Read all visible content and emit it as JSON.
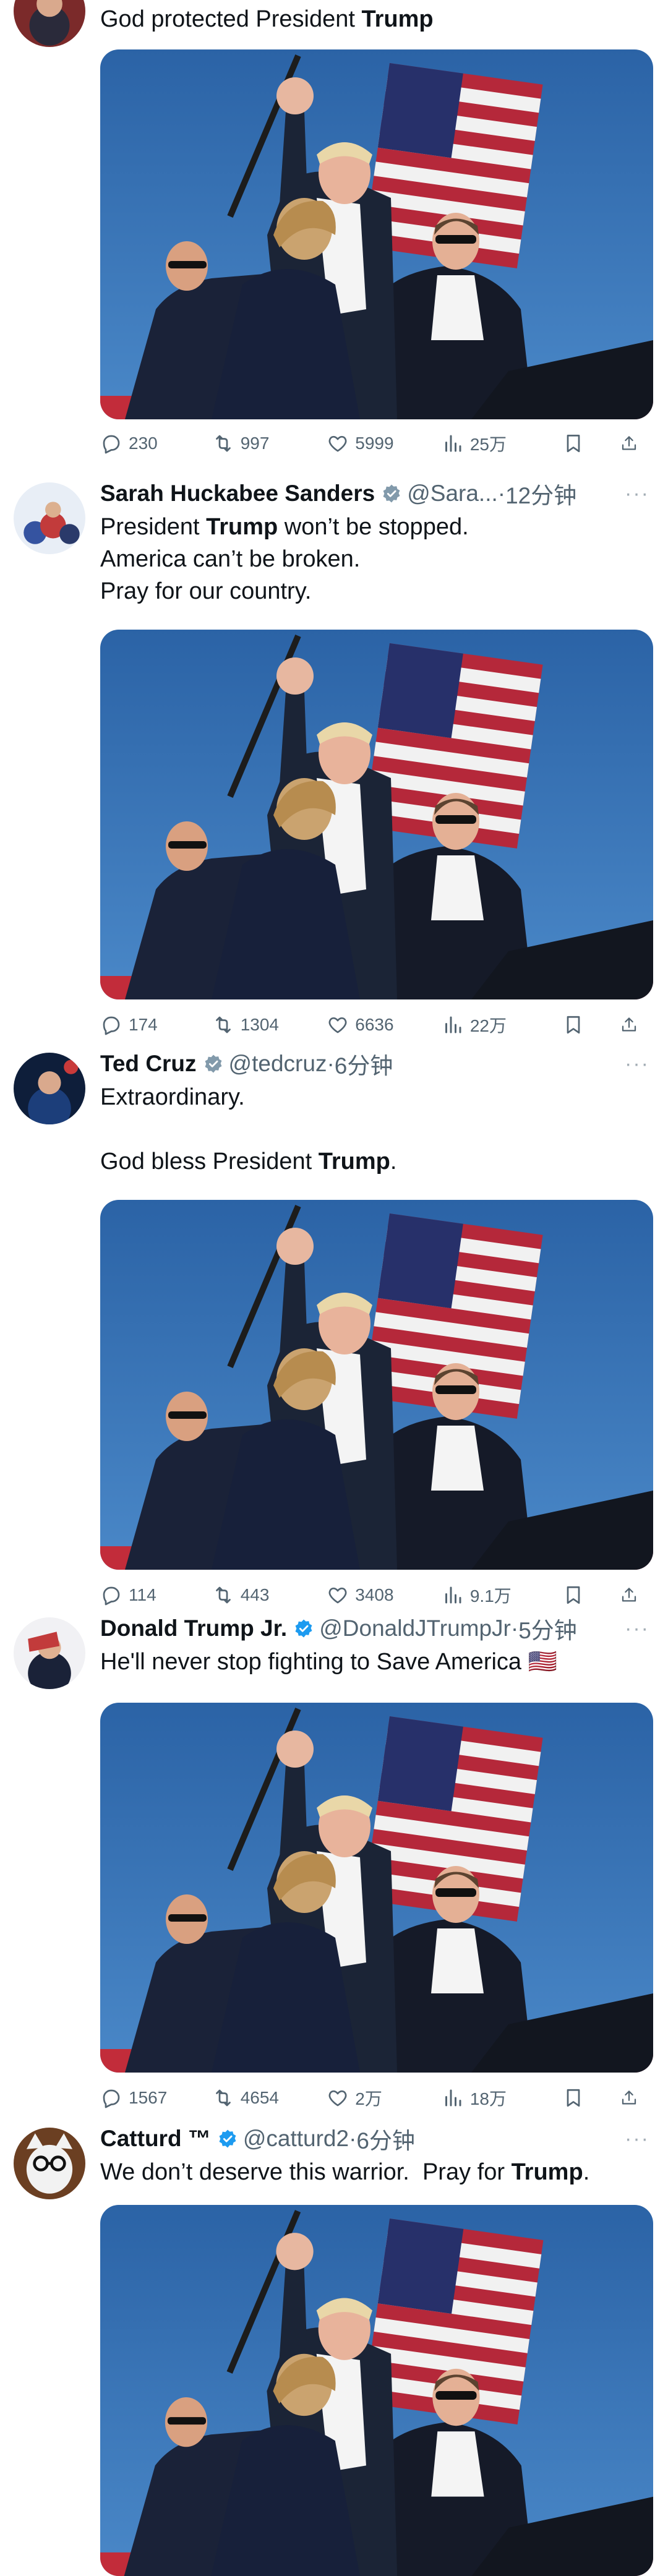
{
  "tweets": [
    {
      "name": "",
      "handle": "",
      "time": "",
      "verified": false,
      "text_before": "God protected President ",
      "text_bold": "Trump",
      "text_after": "",
      "stats": {
        "replies": "230",
        "retweets": "997",
        "likes": "5999",
        "views": "25万"
      }
    },
    {
      "name": "Sarah Huckabee Sanders",
      "handle": "@Sara...",
      "time": "12分钟",
      "verified": true,
      "text_before": "President ",
      "text_bold": "Trump",
      "text_after": " won’t be stopped.\nAmerica can’t be broken.\nPray for our country.",
      "stats": {
        "replies": "174",
        "retweets": "1304",
        "likes": "6636",
        "views": "22万"
      }
    },
    {
      "name": "Ted Cruz",
      "handle": "@tedcruz",
      "time": "6分钟",
      "verified": true,
      "text_before": "Extraordinary.\n\nGod bless President ",
      "text_bold": "Trump",
      "text_after": ".",
      "stats": {
        "replies": "114",
        "retweets": "443",
        "likes": "3408",
        "views": "9.1万"
      }
    },
    {
      "name": "Donald Trump Jr.",
      "handle": "@DonaldJTrumpJr",
      "time": "5分钟",
      "verified": true,
      "text_before": "He'll never stop fighting to Save America 🇺🇸",
      "text_bold": "",
      "text_after": "",
      "stats": {
        "replies": "1567",
        "retweets": "4654",
        "likes": "2万",
        "views": "18万"
      }
    },
    {
      "name": "Catturd ™",
      "handle": "@catturd2",
      "time": "6分钟",
      "verified": true,
      "text_before": "We don’t deserve this warrior.  Pray for ",
      "text_bold": "Trump",
      "text_after": ".",
      "stats": {
        "replies": "",
        "retweets": "",
        "likes": "",
        "views": ""
      }
    }
  ],
  "ui": {
    "dot": "·",
    "more": "···"
  },
  "icons": [
    "reply-icon",
    "retweet-icon",
    "like-icon",
    "views-icon",
    "bookmark-icon",
    "share-icon",
    "verified-badge-icon"
  ],
  "colors": {
    "text": "#0f1419",
    "secondary": "#536471",
    "verified": "#1d9bf0",
    "sky": "#2f6fb3"
  }
}
